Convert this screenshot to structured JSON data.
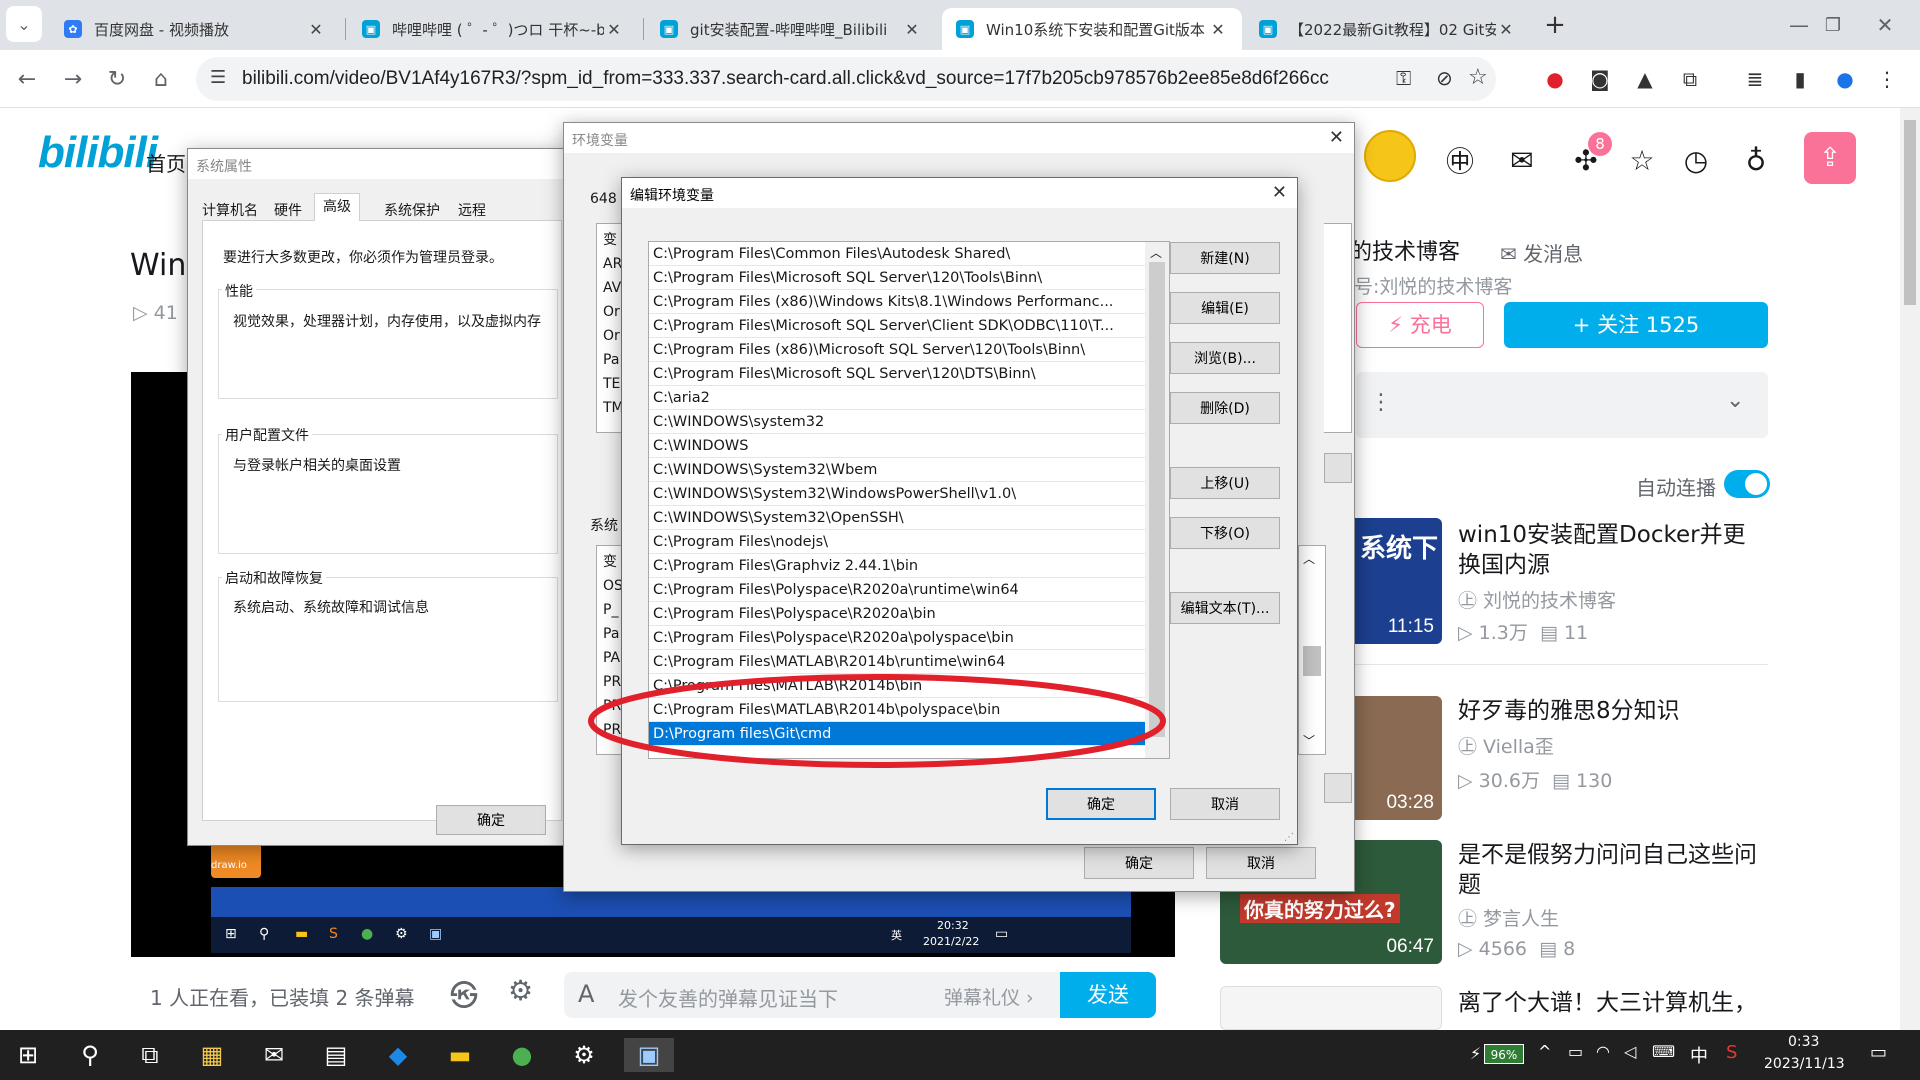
{
  "browser": {
    "tabs": [
      {
        "label": "百度网盘 - 视频播放",
        "color": "#2f7bf5"
      },
      {
        "label": "哔哩哔哩 ( ゜- ゜)つロ 干杯~-bil",
        "color": "#00a1d6"
      },
      {
        "label": "git安装配置-哔哩哔哩_Bilibili",
        "color": "#00a1d6"
      },
      {
        "label": "Win10系统下安装和配置Git版本",
        "color": "#00a1d6"
      },
      {
        "label": "【2022最新Git教程】02 Git安装",
        "color": "#00a1d6"
      }
    ],
    "url": "bilibili.com/video/BV1Af4y167R3/?spm_id_from=333.337.search-card.all.click&vd_source=17f7b205cb978576b2ee85e8d6f266cc",
    "badge_count": "8"
  },
  "bili": {
    "logo": "bilibili",
    "home": "首页",
    "video_title_partial": "Win",
    "play_count_partial": "41",
    "uploader_name": "刘悦的技术博客",
    "uploader_name_partial": "的技术博客",
    "message_label": "发消息",
    "uploader_sub_partial": "号:刘悦的技术博客",
    "charge_label": "充电",
    "follow_label": "+ 关注 1525",
    "autoplay_label": "自动连播",
    "live_viewers": "1 人正在看，已装填 2 条弹幕",
    "danmaku_placeholder": "发个友善的弹幕见证当下",
    "danmaku_etiquette": "弹幕礼仪 ›",
    "send_label": "发送",
    "recommendations": [
      {
        "title": "win10安装配置Docker并更换国内源",
        "author": "刘悦的技术博客",
        "views": "1.3万",
        "danmaku": "11",
        "duration": "11:15",
        "thumb_text": "系统下"
      },
      {
        "title": "好歹毒的雅思8分知识",
        "author": "Viella歪",
        "views": "30.6万",
        "danmaku": "130",
        "duration": "03:28",
        "thumb_text": ""
      },
      {
        "title": "是不是假努力问问自己这些问题",
        "author": "梦言人生",
        "views": "4566",
        "danmaku": "8",
        "duration": "06:47",
        "thumb_text": "你真的努力过么?"
      },
      {
        "title": "离了个大谱！大三计算机生，",
        "author": "",
        "views": "",
        "danmaku": "",
        "duration": "",
        "thumb_text": ""
      }
    ]
  },
  "video_inner": {
    "time": "20:32",
    "date": "2021/2/22",
    "ime": "英",
    "drawio_label": "draw.io"
  },
  "sysprops": {
    "title": "系统属性",
    "tabs": [
      "计算机名",
      "硬件",
      "高级",
      "系统保护",
      "远程"
    ],
    "admin_note": "要进行大多数更改，你必须作为管理员登录。",
    "perf_label": "性能",
    "perf_desc": "视觉效果，处理器计划，内存使用，以及虚拟内存",
    "profile_label": "用户配置文件",
    "profile_desc": "与登录帐户相关的桌面设置",
    "startup_label": "启动和故障恢复",
    "startup_desc": "系统启动、系统故障和调试信息",
    "ok": "确定"
  },
  "envvars": {
    "title": "环境变量",
    "user_vars_partial": "648",
    "col_partial": "变",
    "user_rows": [
      "AR",
      "AV",
      "Or",
      "Or",
      "Pa",
      "TE",
      "TM"
    ],
    "sys_label_partial": "系统",
    "sys_rows": [
      "变",
      "OS",
      "P_",
      "Pa",
      "PA",
      "PR",
      "PR",
      "PR"
    ],
    "ok": "确定",
    "cancel": "取消"
  },
  "editenv": {
    "title": "编辑环境变量",
    "paths": [
      "C:\\Program Files\\Common Files\\Autodesk Shared\\",
      "C:\\Program Files\\Microsoft SQL Server\\120\\Tools\\Binn\\",
      "C:\\Program Files (x86)\\Windows Kits\\8.1\\Windows Performanc...",
      "C:\\Program Files\\Microsoft SQL Server\\Client SDK\\ODBC\\110\\T...",
      "C:\\Program Files (x86)\\Microsoft SQL Server\\120\\Tools\\Binn\\",
      "C:\\Program Files\\Microsoft SQL Server\\120\\DTS\\Binn\\",
      "C:\\aria2",
      "C:\\WINDOWS\\system32",
      "C:\\WINDOWS",
      "C:\\WINDOWS\\System32\\Wbem",
      "C:\\WINDOWS\\System32\\WindowsPowerShell\\v1.0\\",
      "C:\\WINDOWS\\System32\\OpenSSH\\",
      "C:\\Program Files\\nodejs\\",
      "C:\\Program Files\\Graphviz 2.44.1\\bin",
      "C:\\Program Files\\Polyspace\\R2020a\\runtime\\win64",
      "C:\\Program Files\\Polyspace\\R2020a\\bin",
      "C:\\Program Files\\Polyspace\\R2020a\\polyspace\\bin",
      "C:\\Program Files\\MATLAB\\R2014b\\runtime\\win64",
      "C:\\Program Files\\MATLAB\\R2014b\\bin",
      "C:\\Program Files\\MATLAB\\R2014b\\polyspace\\bin",
      "D:\\Program files\\Git\\cmd"
    ],
    "buttons": {
      "new": "新建(N)",
      "edit": "编辑(E)",
      "browse": "浏览(B)...",
      "delete": "删除(D)",
      "up": "上移(U)",
      "down": "下移(O)",
      "edit_text": "编辑文本(T)...",
      "ok": "确定",
      "cancel": "取消"
    },
    "highlight_color": "#e0202a"
  },
  "taskbar": {
    "battery": "96%",
    "ime": "中",
    "time": "0:33",
    "date": "2023/11/13"
  }
}
